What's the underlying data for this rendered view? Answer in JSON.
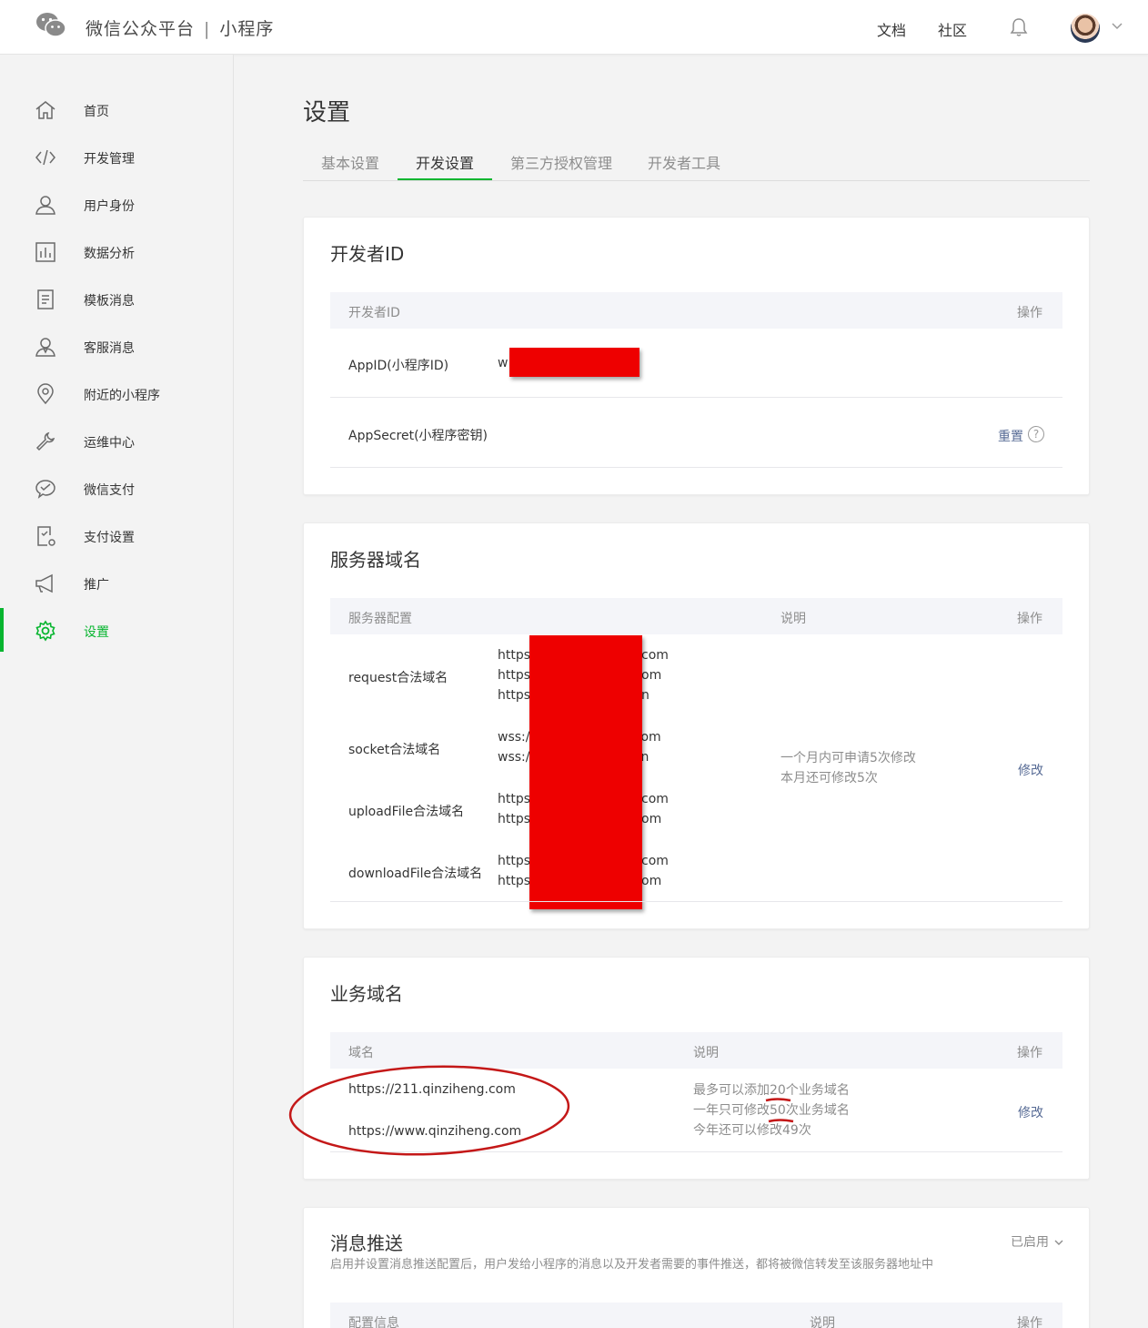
{
  "header": {
    "brand_name": "微信公众平台",
    "brand_separator": "|",
    "brand_product": "小程序",
    "links": [
      "文档",
      "社区"
    ],
    "icons": [
      "wechat-logo-icon",
      "bell-icon",
      "avatar",
      "chevron-down-icon"
    ]
  },
  "sidebar": {
    "items": [
      {
        "label": "首页",
        "icon": "home-icon"
      },
      {
        "label": "开发管理",
        "icon": "code-icon"
      },
      {
        "label": "用户身份",
        "icon": "user-icon"
      },
      {
        "label": "数据分析",
        "icon": "bar-chart-icon"
      },
      {
        "label": "模板消息",
        "icon": "document-icon"
      },
      {
        "label": "客服消息",
        "icon": "service-user-icon"
      },
      {
        "label": "附近的小程序",
        "icon": "location-pin-icon"
      },
      {
        "label": "运维中心",
        "icon": "wrench-icon"
      },
      {
        "label": "微信支付",
        "icon": "wechat-pay-icon"
      },
      {
        "label": "支付设置",
        "icon": "payment-settings-icon"
      },
      {
        "label": "推广",
        "icon": "megaphone-icon"
      },
      {
        "label": "设置",
        "icon": "gear-icon",
        "active": true
      }
    ],
    "active_color": "#07b52f"
  },
  "main": {
    "title": "设置",
    "tabs": [
      "基本设置",
      "开发设置",
      "第三方授权管理",
      "开发者工具"
    ],
    "active_tab": "开发设置"
  },
  "developer_id": {
    "title": "开发者ID",
    "col_id": "开发者ID",
    "col_action": "操作",
    "appid_label": "AppID(小程序ID)",
    "appid_value_prefix": "w",
    "secret_label": "AppSecret(小程序密钥)",
    "secret_action": "重置",
    "help_glyph": "?"
  },
  "server_domains": {
    "title": "服务器域名",
    "col_config": "服务器配置",
    "col_desc": "说明",
    "col_action": "操作",
    "rows": [
      {
        "label": "request合法域名",
        "fragments": [
          {
            "prefix": "https",
            "suffix": "com"
          },
          {
            "prefix": "https",
            "suffix": "om"
          },
          {
            "prefix": "https",
            "suffix": "n"
          }
        ]
      },
      {
        "label": "socket合法域名",
        "fragments": [
          {
            "prefix": "wss:/",
            "suffix": "om"
          },
          {
            "prefix": "wss:/",
            "suffix": "n"
          }
        ]
      },
      {
        "label": "uploadFile合法域名",
        "fragments": [
          {
            "prefix": "https",
            "suffix": "com"
          },
          {
            "prefix": "https",
            "suffix": "om"
          }
        ]
      },
      {
        "label": "downloadFile合法域名",
        "fragments": [
          {
            "prefix": "https",
            "suffix": "com"
          },
          {
            "prefix": "https",
            "suffix": "om"
          }
        ]
      }
    ],
    "desc_line1": "一个月内可申请5次修改",
    "desc_line2": "本月还可修改5次",
    "action": "修改"
  },
  "business_domains": {
    "title": "业务域名",
    "col_domain": "域名",
    "col_desc": "说明",
    "col_action": "操作",
    "domains": [
      "https://211.qinziheng.com",
      "https://www.qinziheng.com"
    ],
    "desc_line1": "最多可以添加20个业务域名",
    "desc_line2": "一年只可修改50次业务域名",
    "desc_line3": "今年还可以修改49次",
    "action": "修改"
  },
  "message_push": {
    "title": "消息推送",
    "description": "启用并设置消息推送配置后，用户发给小程序的消息以及开发者需要的事件推送，都将被微信转发至该服务器地址中",
    "status": "已启用",
    "col_config": "配置信息",
    "col_desc": "说明",
    "col_action": "操作"
  },
  "colors": {
    "accent": "#07b52f",
    "link": "#576b95",
    "redaction": "#ee0000",
    "annotation": "#c41818"
  }
}
